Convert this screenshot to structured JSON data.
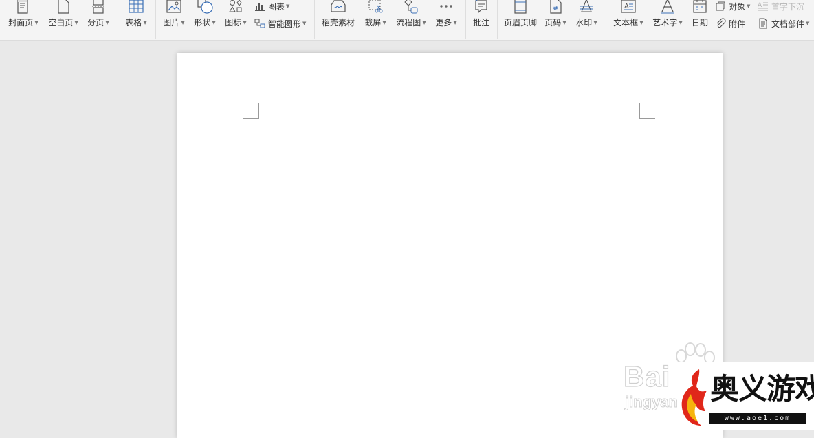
{
  "ribbon": {
    "cover_page": "封面页",
    "blank_page": "空白页",
    "page_break": "分页",
    "table": "表格",
    "picture": "图片",
    "shape": "形状",
    "icon": "图标",
    "chart": "图表",
    "smart_art": "智能图形",
    "docer_material": "稻壳素材",
    "screenshot": "截屏",
    "flowchart": "流程图",
    "more": "更多",
    "comment": "批注",
    "header_footer": "页眉页脚",
    "page_number": "页码",
    "watermark": "水印",
    "text_box": "文本框",
    "word_art": "艺术字",
    "date": "日期",
    "object": "对象",
    "attachment": "附件",
    "drop_cap": "首字下沉",
    "doc_parts": "文档部件"
  },
  "watermark_overlay": {
    "baidu_text": "Bai",
    "jingyan_text": "jingyan"
  },
  "site_logo": {
    "name": "奥义游戏网",
    "url": "www.aoe1.com"
  }
}
